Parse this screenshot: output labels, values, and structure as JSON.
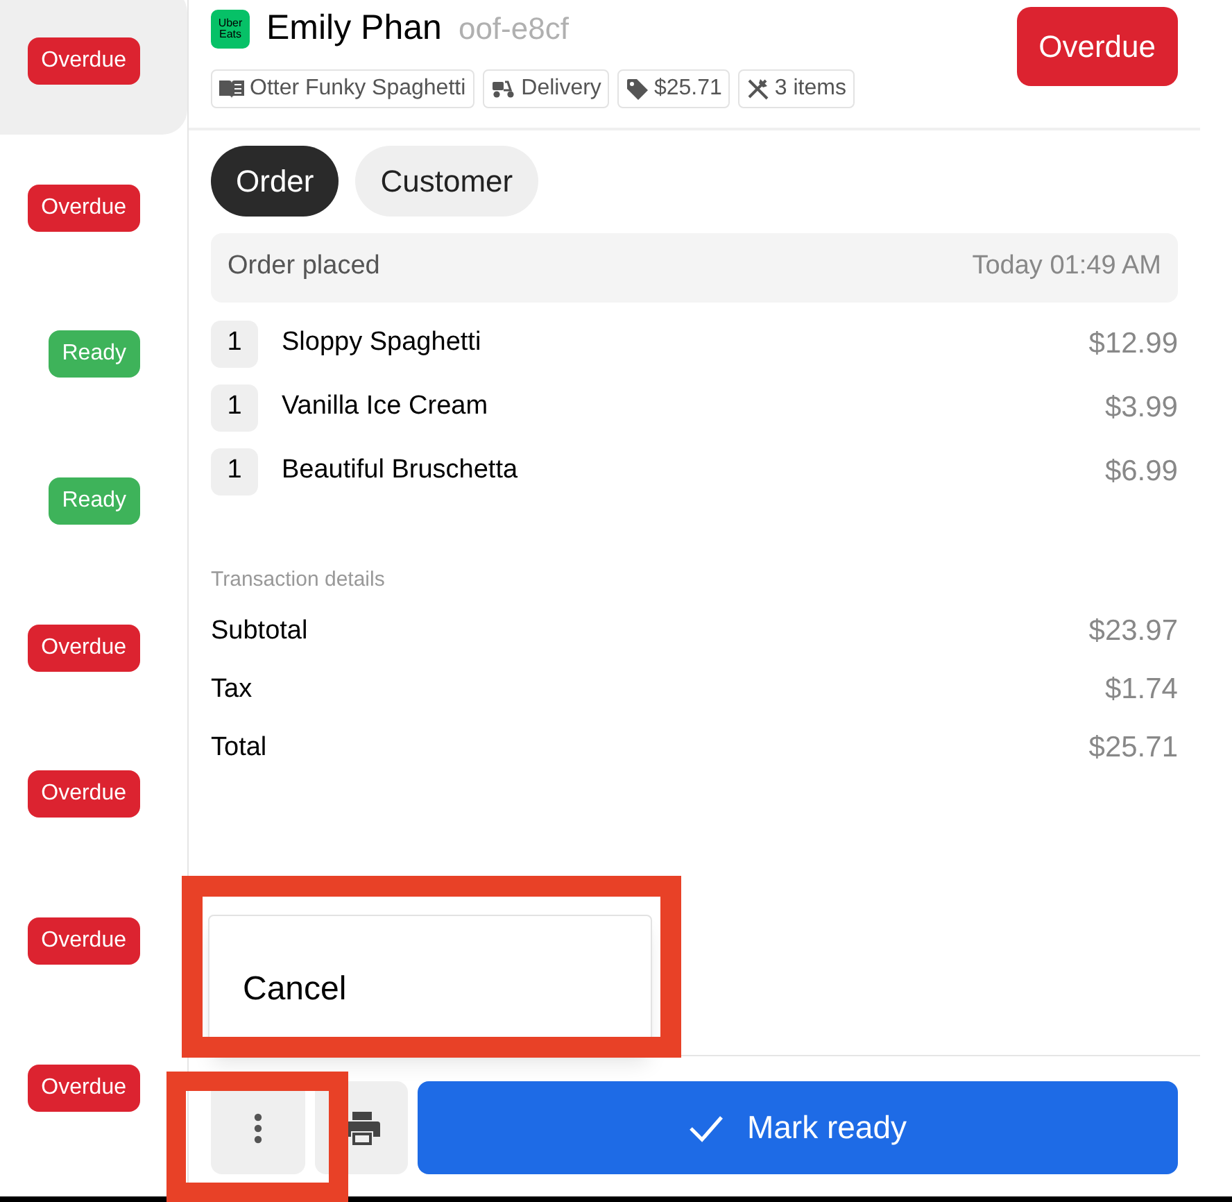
{
  "sidebar": {
    "orders": [
      {
        "status": "Overdue",
        "kind": "overdue",
        "selected": true
      },
      {
        "status": "Overdue",
        "kind": "overdue",
        "selected": false
      },
      {
        "status": "Ready",
        "kind": "ready",
        "selected": false
      },
      {
        "status": "Ready",
        "kind": "ready",
        "selected": false
      },
      {
        "status": "Overdue",
        "kind": "overdue",
        "selected": false
      },
      {
        "status": "Overdue",
        "kind": "overdue",
        "selected": false
      },
      {
        "status": "Overdue",
        "kind": "overdue",
        "selected": false
      },
      {
        "status": "Overdue",
        "kind": "overdue",
        "selected": false
      }
    ]
  },
  "order": {
    "logo": {
      "line1": "Uber",
      "line2": "Eats"
    },
    "customer_name": "Emily Phan",
    "order_code": "oof-e8cf",
    "status_button": "Overdue",
    "chips": [
      {
        "kind": "store",
        "label": "Otter Funky Spaghetti"
      },
      {
        "kind": "delivery",
        "label": "Delivery"
      },
      {
        "kind": "price",
        "label": "$25.71"
      },
      {
        "kind": "items",
        "label": "3 items"
      }
    ],
    "tabs": [
      {
        "label": "Order",
        "selected": true
      },
      {
        "label": "Customer",
        "selected": false
      }
    ],
    "placed": {
      "label": "Order placed",
      "time": "Today 01:49 AM"
    },
    "items": [
      {
        "qty": "1",
        "name": "Sloppy Spaghetti",
        "price": "$12.99"
      },
      {
        "qty": "1",
        "name": "Vanilla Ice Cream",
        "price": "$3.99"
      },
      {
        "qty": "1",
        "name": "Beautiful Bruschetta",
        "price": "$6.99"
      }
    ],
    "transaction": {
      "title": "Transaction details",
      "rows": [
        {
          "label": "Subtotal",
          "value": "$23.97"
        },
        {
          "label": "Tax",
          "value": "$1.74"
        },
        {
          "label": "Total",
          "value": "$25.71"
        }
      ]
    },
    "menu": [
      {
        "label": "Cancel"
      }
    ],
    "actions": {
      "primary": "Mark ready"
    }
  }
}
